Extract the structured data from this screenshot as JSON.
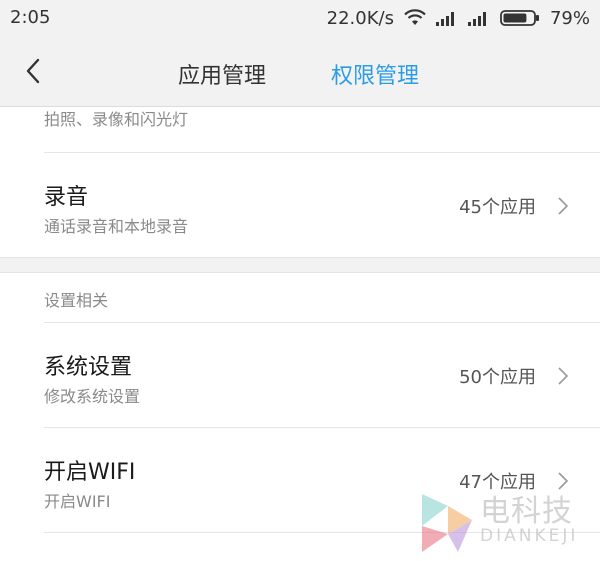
{
  "status": {
    "time": "2:05",
    "network_speed": "22.0K/s",
    "battery_percent": "79%",
    "battery_level": 0.79,
    "icons": [
      "wifi-icon",
      "signal-icon",
      "signal-icon",
      "battery-icon"
    ]
  },
  "nav": {
    "back_icon": "chevron-left-icon",
    "tabs": [
      {
        "label": "应用管理",
        "active": false
      },
      {
        "label": "权限管理",
        "active": true
      }
    ],
    "active_color": "#2d9ce6"
  },
  "list": {
    "partial_row": {
      "subtitle": "拍照、录像和闪光灯"
    },
    "rows": [
      {
        "title": "录音",
        "subtitle": "通话录音和本地录音",
        "count": "45个应用"
      },
      {
        "title": "系统设置",
        "subtitle": "修改系统设置",
        "count": "50个应用"
      },
      {
        "title": "开启WIFI",
        "subtitle": "开启WIFI",
        "count": "47个应用"
      }
    ],
    "section_header": "设置相关"
  },
  "watermark": {
    "brand_cn": "电科技",
    "brand_en": "DIANKEJI"
  }
}
